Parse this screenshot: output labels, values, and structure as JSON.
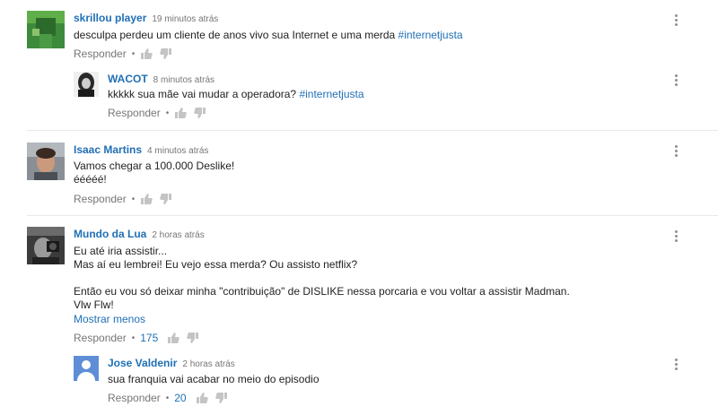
{
  "comments": [
    {
      "author": "skrillou player",
      "time": "19 minutos atrás",
      "lines": [
        "desculpa perdeu um cliente  de anos vivo sua Internet e uma merda "
      ],
      "hashtag": "#internetjusta",
      "reply_label": "Responder",
      "replies": [
        {
          "author": "WACOT",
          "time": "8 minutos atrás",
          "text": "kkkkk sua mãe vai mudar a operadora? ",
          "hashtag": "#internetjusta",
          "reply_label": "Responder"
        }
      ]
    },
    {
      "author": "Isaac Martins",
      "time": "4 minutos atrás",
      "lines": [
        "Vamos chegar a 100.000 Deslike!",
        "ééééé!"
      ],
      "reply_label": "Responder"
    },
    {
      "author": "Mundo da Lua",
      "time": "2 horas atrás",
      "lines": [
        "Eu até iria assistir...",
        "Mas aí eu lembrei! Eu vejo essa merda? Ou assisto netflix?",
        "",
        "Então eu vou só deixar minha \"contribuição\" de DISLIKE nessa porcaria e vou voltar a assistir Madman.",
        "Vlw Flw!"
      ],
      "show_less": "Mostrar menos",
      "reply_label": "Responder",
      "likes": "175",
      "replies": [
        {
          "author": "Jose Valdenir",
          "time": "2 horas atrás",
          "text": "sua franquia vai acabar no meio do episodio",
          "reply_label": "Responder",
          "likes": "20"
        }
      ]
    }
  ],
  "icons": {
    "like": "thumbs-up-icon",
    "dislike": "thumbs-down-icon",
    "menu": "more-vert-icon"
  },
  "colors": {
    "author": "#1f6fb5",
    "meta": "#767676",
    "icon": "#c4c4c4"
  }
}
